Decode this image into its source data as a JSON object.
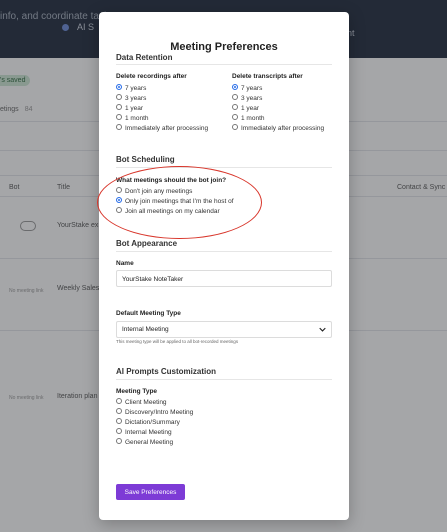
{
  "background": {
    "header_title": "info, and coordinate task",
    "card1": "AI S",
    "card2": "nt",
    "saved_badge": "'s saved",
    "meetings_tab": "etings",
    "meetings_count": "84",
    "col_bot": "Bot",
    "col_title": "Title",
    "col_contact": "Contact & Sync",
    "rows": [
      {
        "title": "YourStake ex"
      },
      {
        "bot": "No meeting link",
        "title": "Weekly Sales"
      },
      {
        "bot": "No meeting link",
        "title": "Iteration plan"
      }
    ]
  },
  "modal": {
    "title": "Meeting Preferences",
    "data_retention": {
      "heading": "Data Retention",
      "recordings_label": "Delete recordings after",
      "transcripts_label": "Delete transcripts after",
      "options": [
        "7 years",
        "3 years",
        "1 year",
        "1 month",
        "Immediately after processing"
      ],
      "recordings_selected": 0,
      "transcripts_selected": 0
    },
    "bot_scheduling": {
      "heading": "Bot Scheduling",
      "question": "What meetings should the bot join?",
      "options": [
        "Don't join any meetings",
        "Only join meetings that I'm the host of",
        "Join all meetings on my calendar"
      ],
      "selected": 1
    },
    "bot_appearance": {
      "heading": "Bot Appearance",
      "name_label": "Name",
      "name_value": "YourStake NoteTaker",
      "meeting_type_label": "Default Meeting Type",
      "meeting_type_value": "Internal Meeting",
      "meeting_type_hint": "This meeting type will be applied to all bot-recorded meetings"
    },
    "ai_prompts": {
      "heading": "AI Prompts Customization",
      "meeting_type_label": "Meeting Type",
      "options": [
        "Client Meeting",
        "Discovery/Intro Meeting",
        "Dictation/Summary",
        "Internal Meeting",
        "General Meeting"
      ]
    },
    "save_label": "Save Preferences"
  },
  "colors": {
    "accent": "#7d3bd6",
    "radio_selected": "#2a6ee8",
    "highlight": "#d8352a"
  }
}
